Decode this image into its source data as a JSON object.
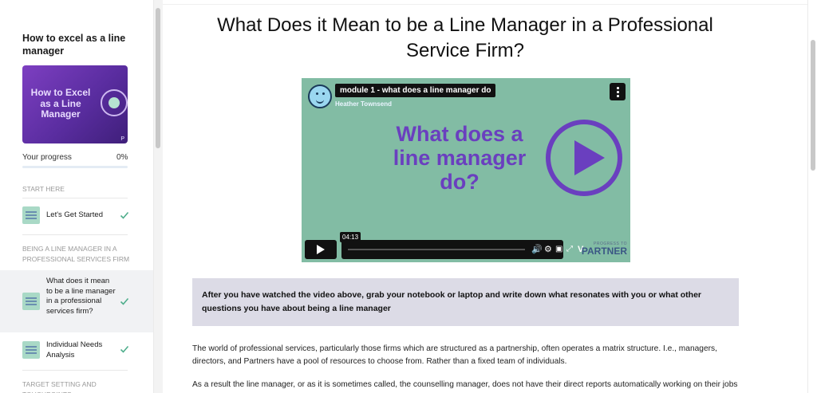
{
  "sidebar": {
    "course_title": "How to excel as a line manager",
    "thumbnail_text": "How to Excel as a Line Manager",
    "progress_label": "Your progress",
    "progress_pct": "0%",
    "progress_value": 0,
    "sections": [
      {
        "heading": "START HERE"
      },
      {
        "heading": "BEING A LINE MANAGER IN A PROFESSIONAL SERVICES FIRM"
      },
      {
        "heading": "TARGET SETTING AND TOUCHPOINTS"
      }
    ],
    "lessons": [
      {
        "label": "Let's Get Started",
        "completed": true
      },
      {
        "label": "What does it mean to be a line manager in a professional services firm?",
        "completed": true,
        "active": true
      },
      {
        "label": "Individual Needs Analysis",
        "completed": true
      }
    ]
  },
  "main": {
    "title": "What Does it Mean to be a Line Manager in a Professional Service Firm?",
    "video": {
      "title": "module 1 - what does a line manager do",
      "author": "Heather Townsend",
      "big_text": "What does a line manager do?",
      "timestamp": "04:13",
      "brand_small": "PROGRESS TO",
      "brand_large": "PARTNER"
    },
    "callout": "After you have watched the video above, grab your notebook or laptop and write down what resonates with you or what other questions you have about being a line manager",
    "paragraphs": [
      "The world of professional services, particularly those firms which are structured as a partnership, often operates a matrix structure. I.e., managers, directors, and Partners have a pool of resources to choose from. Rather than a fixed team of individuals.",
      "As a result the line manager, or as it is sometimes called, the counselling manager, does not have their direct reports automatically working on their jobs and engagements with them."
    ]
  },
  "colors": {
    "accent_purple": "#6a3fbf",
    "video_bg": "#82bca4",
    "check_green": "#4fae8c",
    "callout_bg": "#dcdbe6"
  }
}
